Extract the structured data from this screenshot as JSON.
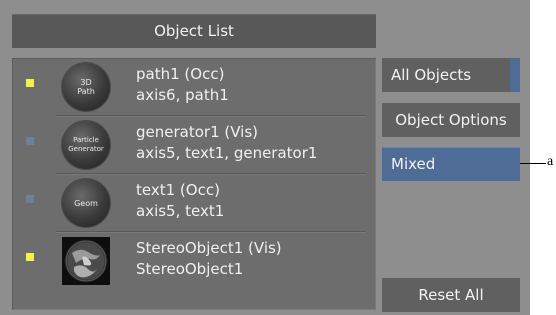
{
  "object_list": {
    "title": "Object List",
    "rows": [
      {
        "marker_color": "#f2f24a",
        "thumb_label": "3D Path",
        "line1": "path1 (Occ)",
        "line2": "axis6, path1",
        "thumb_icon": "3d-path-icon"
      },
      {
        "marker_color": "#6e7f9a",
        "thumb_label": "Particle Generator",
        "line1": "generator1 (Vis)",
        "line2": "axis5, text1, generator1",
        "thumb_icon": "particle-generator-icon"
      },
      {
        "marker_color": "#6e7f9a",
        "thumb_label": "Geom",
        "line1": "text1 (Occ)",
        "line2": "axis5, text1",
        "thumb_icon": "geom-icon"
      },
      {
        "marker_color": "#f2f24a",
        "thumb_label": "",
        "line1": "StereoObject1 (Vis)",
        "line2": "StereoObject1",
        "thumb_icon": "globe-thumbnail-icon"
      }
    ]
  },
  "buttons": {
    "all_objects": "All Objects",
    "object_options": "Object Options",
    "mixed": "Mixed",
    "reset_all": "Reset All"
  },
  "callout": {
    "label": "a"
  },
  "colors": {
    "accent": "#4f6c96",
    "panel": "#8e8e8e",
    "list_bg": "#6d6d6d",
    "button": "#606060"
  }
}
